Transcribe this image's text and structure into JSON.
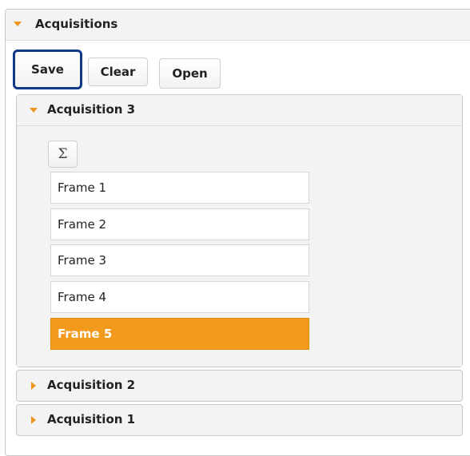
{
  "accordion": {
    "title": "Acquisitions",
    "accent_color": "#f0941d",
    "expanded_icon": "caret-down-icon",
    "collapsed_icon": "caret-right-icon"
  },
  "toolbar": {
    "save_label": "Save",
    "clear_label": "Clear",
    "open_label": "Open",
    "focused_button_color": "#0f3a8a"
  },
  "acquisitions": [
    {
      "title": "Acquisition 3",
      "expanded": true,
      "sum_icon": "sigma-icon",
      "sum_symbol": "Σ",
      "frames": [
        {
          "label": "Frame 1",
          "selected": false
        },
        {
          "label": "Frame 2",
          "selected": false
        },
        {
          "label": "Frame 3",
          "selected": false
        },
        {
          "label": "Frame 4",
          "selected": false
        },
        {
          "label": "Frame 5",
          "selected": true
        }
      ],
      "selected_color": "#f29a1c"
    },
    {
      "title": "Acquisition 2",
      "expanded": false
    },
    {
      "title": "Acquisition 1",
      "expanded": false
    }
  ]
}
